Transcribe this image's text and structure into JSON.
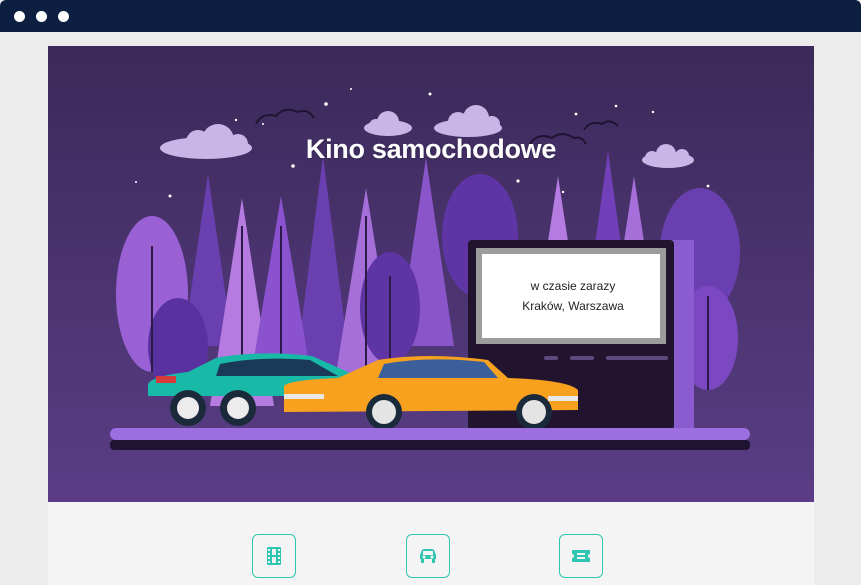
{
  "window": {
    "controls": [
      "dot",
      "dot",
      "dot"
    ]
  },
  "hero": {
    "title": "Kino samochodowe",
    "screen_line1": "w czasie zarazy",
    "screen_line2": "Kraków, Warszawa"
  },
  "colors": {
    "titlebar": "#0c1f40",
    "sky_top": "#3b2a59",
    "sky_bottom": "#5a3d86",
    "accent_teal": "#2fc6b1",
    "car_orange": "#f7a11e",
    "car_teal": "#19b9a8"
  },
  "features": [
    {
      "icon": "film-icon"
    },
    {
      "icon": "car-icon"
    },
    {
      "icon": "ticket-icon"
    }
  ]
}
